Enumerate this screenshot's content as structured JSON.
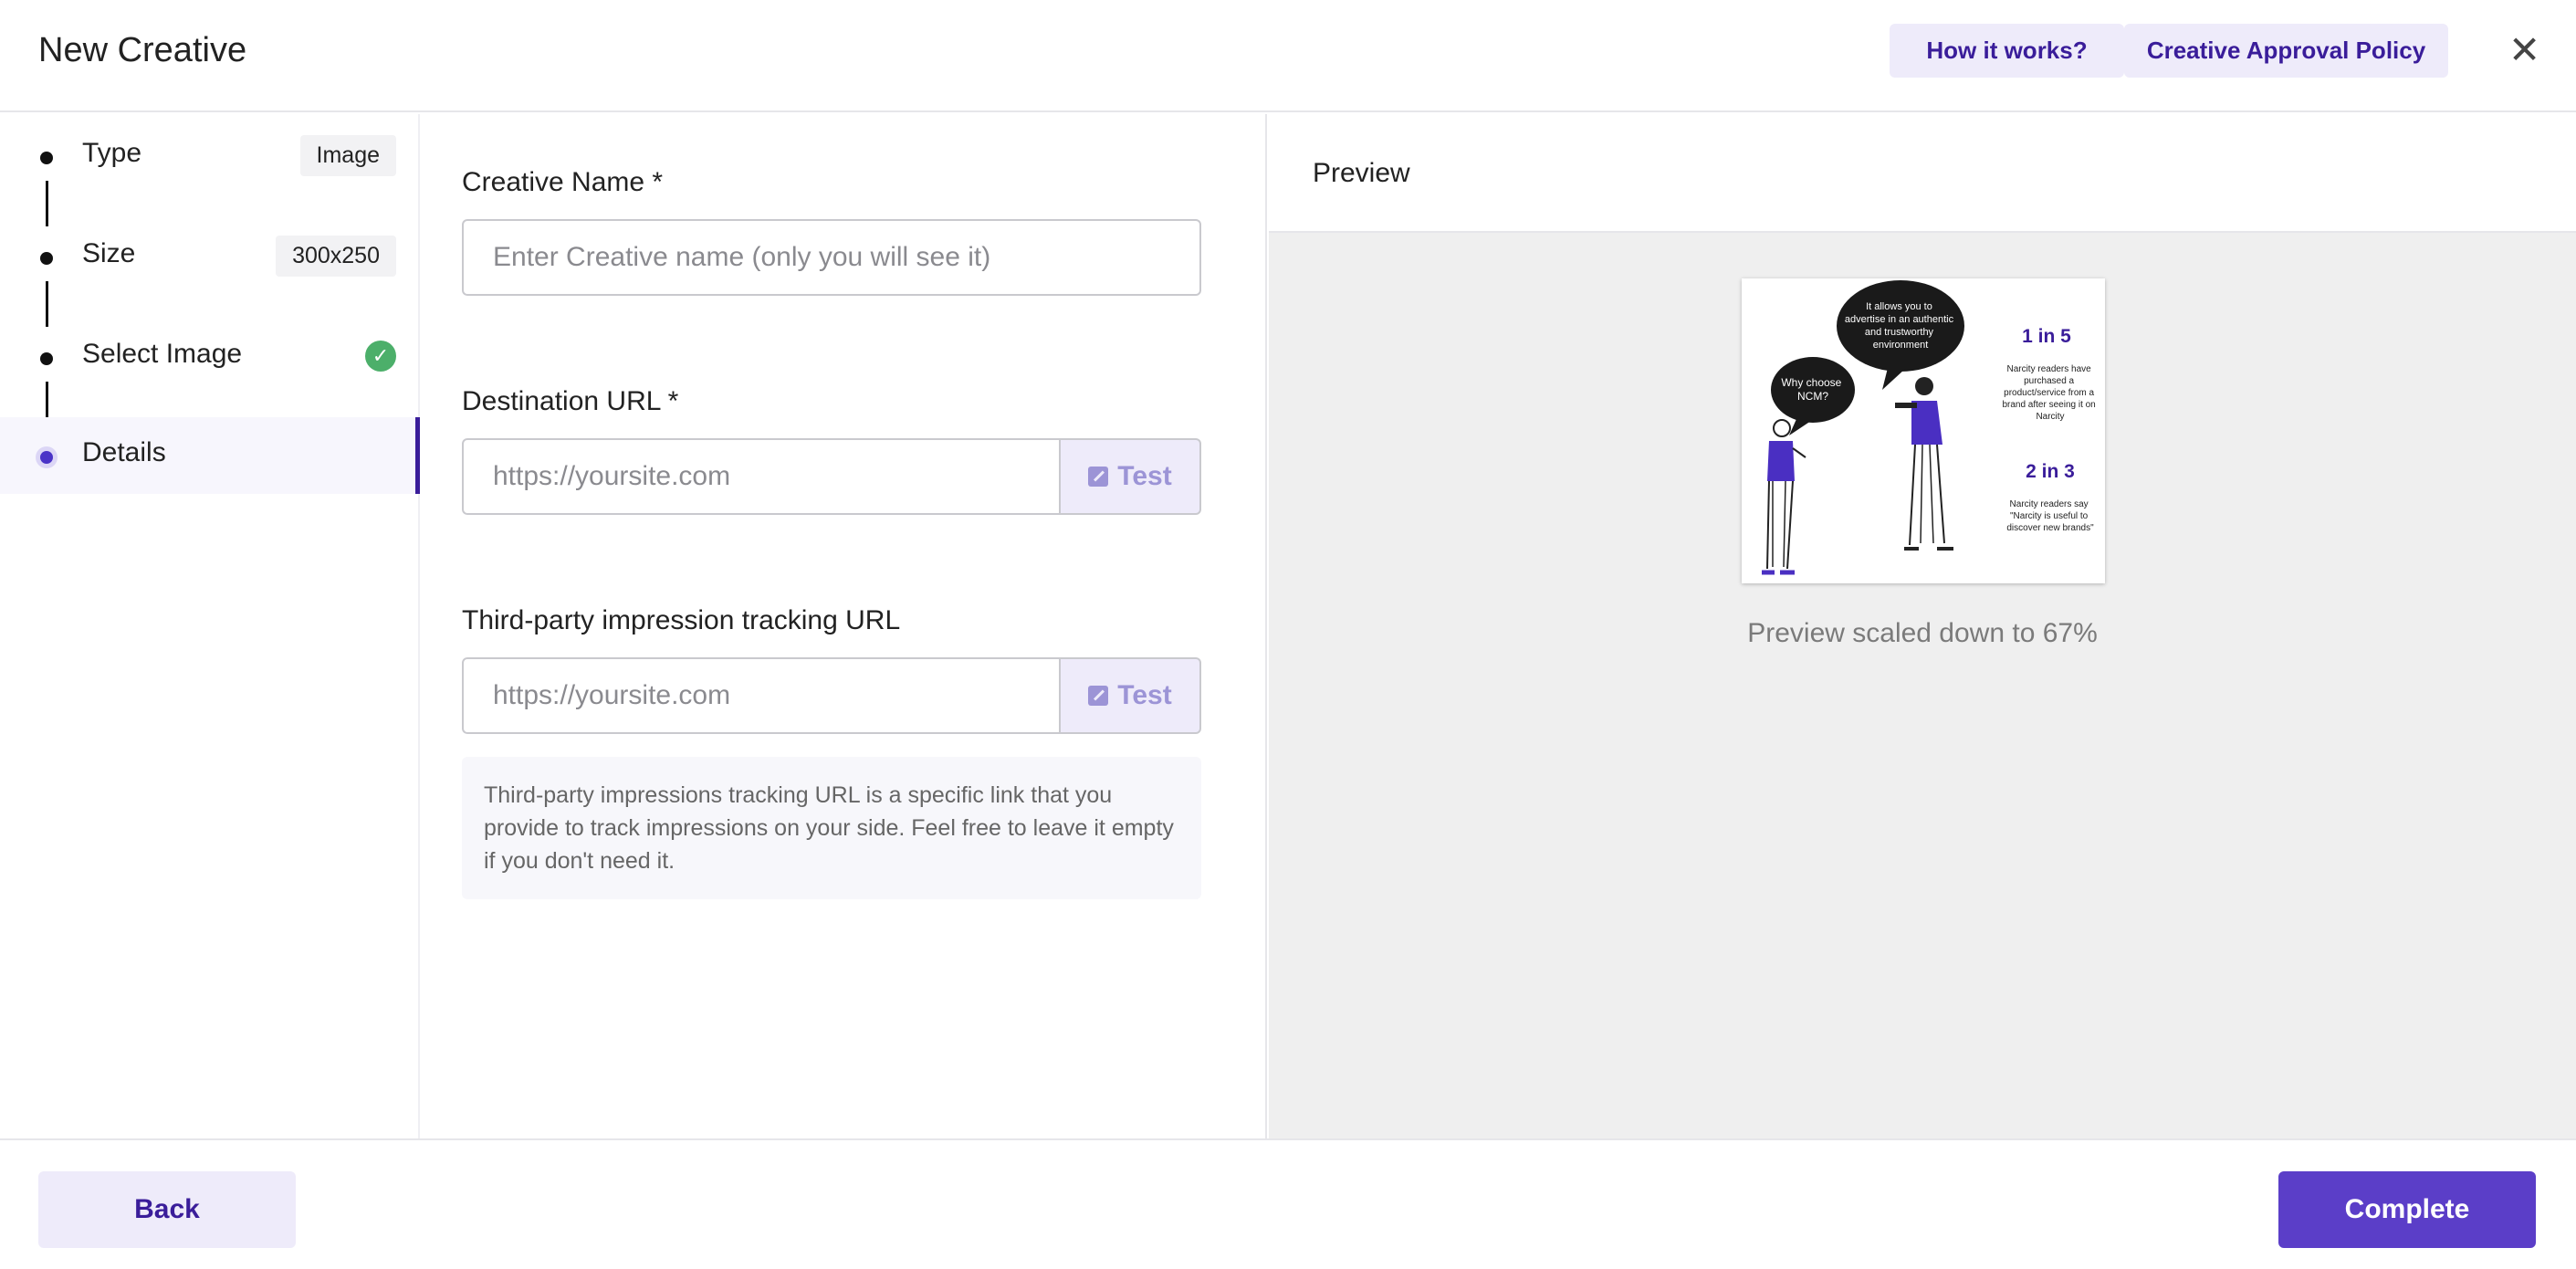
{
  "header": {
    "title": "New Creative",
    "how_label": "How it works?",
    "policy_label": "Creative Approval Policy",
    "close_glyph": "✕"
  },
  "stepper": {
    "steps": [
      {
        "label": "Type",
        "value": "Image"
      },
      {
        "label": "Size",
        "value": "300x250"
      },
      {
        "label": "Select Image",
        "status": "completed"
      },
      {
        "label": "Details",
        "status": "active"
      }
    ]
  },
  "form": {
    "name_label": "Creative Name *",
    "name_placeholder": "Enter Creative name (only you will see it)",
    "destination_label": "Destination URL *",
    "destination_placeholder": "https://yoursite.com",
    "test_label": "Test",
    "tracking_label": "Third-party impression tracking URL",
    "tracking_placeholder": "https://yoursite.com",
    "help_text": "Third-party impressions tracking URL is a specific link that you provide to track impressions on your side. Feel free to leave it empty if you don't need it."
  },
  "preview": {
    "title": "Preview",
    "scaled_text": "Preview scaled down to 67%",
    "creative": {
      "bubble_left": [
        "Why choose",
        "NCM?"
      ],
      "bubble_top": [
        "It allows you to",
        "advertise in an authentic",
        "and trustworthy",
        "environment"
      ],
      "stat1": "1 in 5",
      "stat1_text": [
        "Narcity readers have",
        "purchased a",
        "product/service from a",
        "brand after seeing it on",
        "Narcity"
      ],
      "stat2": "2 in 3",
      "stat2_text": [
        "Narcity readers say",
        "\"Narcity is useful to",
        "discover new brands\""
      ]
    }
  },
  "footer": {
    "back_label": "Back",
    "complete_label": "Complete"
  },
  "colors": {
    "accent": "#5b3ec8",
    "accent_dark": "#3a1d9a",
    "accent_light": "#eeebfa",
    "success": "#4caf6a"
  }
}
